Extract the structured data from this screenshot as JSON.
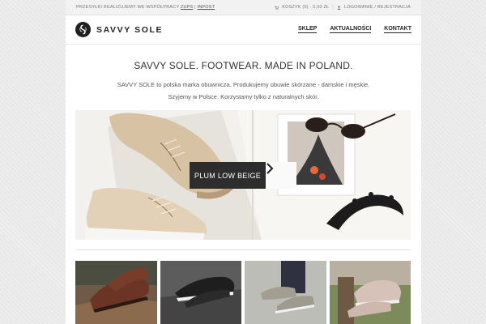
{
  "topbar": {
    "shipping_text": "PRZESYŁKI REALIZUJEMY WE WSPÓŁPRACY",
    "shipping_link_1": "ZUPS",
    "separator": "|",
    "shipping_link_2": "INPOST",
    "cart_label": "KOSZYK (0) · 0,00 ZŁ",
    "account_label": "LOGOWANIE / REJESTRACJA"
  },
  "header": {
    "logo_text": "SAVVY SOLE",
    "nav": [
      {
        "label": "SKLEP"
      },
      {
        "label": "AKTUALNOŚCI"
      },
      {
        "label": "KONTAKT"
      }
    ]
  },
  "intro": {
    "title": "SAVVY SOLE. FOOTWEAR. MADE IN POLAND.",
    "line1": "SAVVY SOLE to polska marka obuwnicza. Produkujemy obuwie skórzane - damskie i męskie.",
    "line2": "Szyjemy w Polsce. Korzystamy tylko z naturalnych skór."
  },
  "hero": {
    "caption": "PLUM LOW BEIGE",
    "next_icon": "chevron-right-icon"
  },
  "thumbnails": [
    {
      "name": "brown-shoes-on-wood"
    },
    {
      "name": "black-patent-shoes"
    },
    {
      "name": "grey-shoes-worn"
    },
    {
      "name": "pink-shoes-on-moss"
    }
  ],
  "colors": {
    "text_dark": "#222222",
    "caption_bg": "#2d2d2d",
    "page_bg": "#ffffff"
  }
}
